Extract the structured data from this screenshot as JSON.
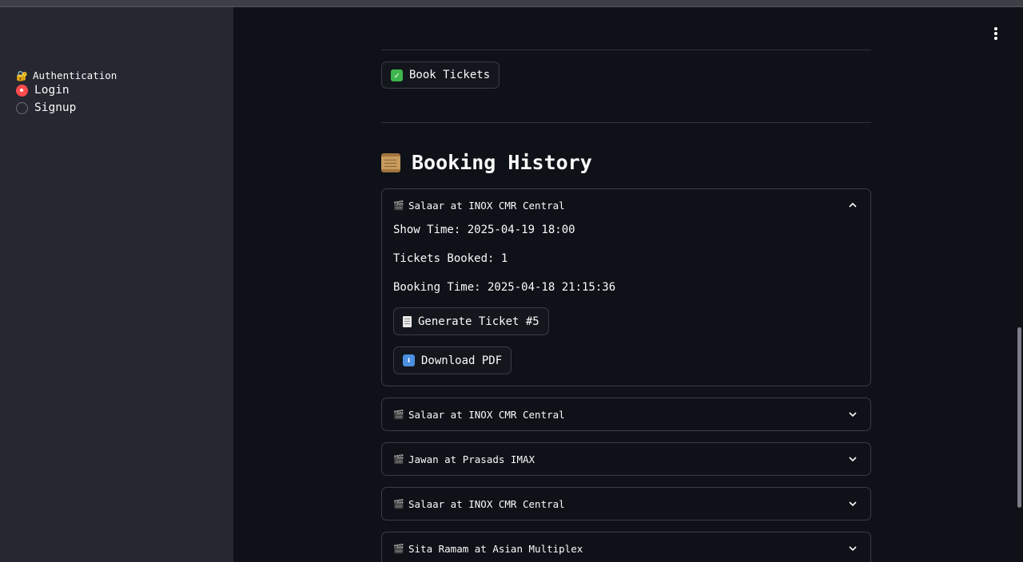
{
  "sidebar": {
    "section_icon": "lock-with-key-icon",
    "section_title": "Authentication",
    "options": [
      {
        "label": "Login",
        "selected": true
      },
      {
        "label": "Signup",
        "selected": false
      }
    ]
  },
  "main": {
    "book_button": {
      "icon": "check-mark-icon",
      "label": "Book Tickets"
    },
    "history": {
      "icon": "scroll-icon",
      "title": "Booking History",
      "items": [
        {
          "icon": "clapper-board-icon",
          "title": "Salaar at INOX CMR Central",
          "expanded": true,
          "show_time": "Show Time: 2025-04-19 18:00",
          "tickets_booked": "Tickets Booked: 1",
          "booking_time": "Booking Time: 2025-04-18 21:15:36",
          "generate_label": "Generate Ticket #5",
          "download_label": "Download PDF"
        },
        {
          "icon": "clapper-board-icon",
          "title": "Salaar at INOX CMR Central",
          "expanded": false
        },
        {
          "icon": "clapper-board-icon",
          "title": "Jawan at Prasads IMAX",
          "expanded": false
        },
        {
          "icon": "clapper-board-icon",
          "title": "Salaar at INOX CMR Central",
          "expanded": false
        },
        {
          "icon": "clapper-board-icon",
          "title": "Sita Ramam at Asian Multiplex",
          "expanded": false
        }
      ]
    }
  },
  "colors": {
    "background": "#0e1117",
    "sidebar": "#262730",
    "accent": "#ff4b4b",
    "border": "#3b3d45",
    "text": "#fafafa"
  }
}
